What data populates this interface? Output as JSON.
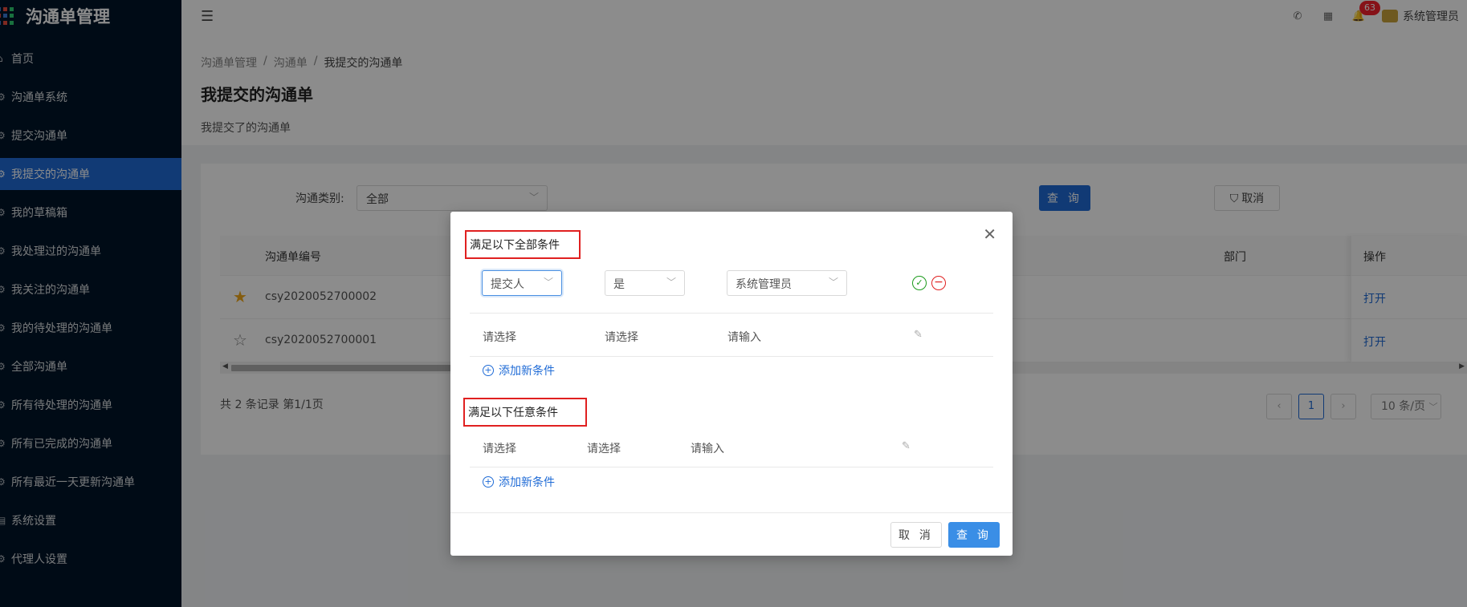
{
  "app": {
    "title": "沟通单管理"
  },
  "sidebar": {
    "items": [
      {
        "label": "首页",
        "icon": "home-icon",
        "glyph": "⌂"
      },
      {
        "label": "沟通单系统",
        "icon": "gear-icon",
        "glyph": "⚙"
      },
      {
        "label": "提交沟通单",
        "icon": "gear-icon",
        "glyph": "⚙"
      },
      {
        "label": "我提交的沟通单",
        "icon": "gear-icon",
        "glyph": "⚙",
        "active": true
      },
      {
        "label": "我的草稿箱",
        "icon": "gear-icon",
        "glyph": "⚙"
      },
      {
        "label": "我处理过的沟通单",
        "icon": "gear-icon",
        "glyph": "⚙"
      },
      {
        "label": "我关注的沟通单",
        "icon": "gear-icon",
        "glyph": "⚙"
      },
      {
        "label": "我的待处理的沟通单",
        "icon": "gear-icon",
        "glyph": "⚙"
      },
      {
        "label": "全部沟通单",
        "icon": "gear-icon",
        "glyph": "⚙"
      },
      {
        "label": "所有待处理的沟通单",
        "icon": "gear-icon",
        "glyph": "⚙"
      },
      {
        "label": "所有已完成的沟通单",
        "icon": "gear-icon",
        "glyph": "⚙"
      },
      {
        "label": "所有最近一天更新沟通单",
        "icon": "gear-icon",
        "glyph": "⚙"
      },
      {
        "label": "系统设置",
        "icon": "settings-icon",
        "glyph": "▤"
      },
      {
        "label": "代理人设置",
        "icon": "gear-icon",
        "glyph": "⚙"
      }
    ]
  },
  "header": {
    "notification_count": "63",
    "username": "系统管理员"
  },
  "page": {
    "breadcrumb": [
      "沟通单管理",
      "沟通单",
      "我提交的沟通单"
    ],
    "title": "我提交的沟通单",
    "description": "我提交了的沟通单"
  },
  "filter": {
    "label": "沟通类别:",
    "value": "全部",
    "query_label": "查 询",
    "cancel_label": "取消"
  },
  "table": {
    "columns": {
      "number": "沟通单编号",
      "dept": "部门",
      "action": "操作"
    },
    "rows": [
      {
        "starred": true,
        "number": "csy2020052700002",
        "action": "打开"
      },
      {
        "starred": false,
        "number": "csy2020052700001",
        "action": "打开"
      }
    ],
    "total": "共 2 条记录 第1/1页",
    "page": "1",
    "page_size": "10 条/页"
  },
  "modal": {
    "group_all_title": "满足以下全部条件",
    "group_any_title": "满足以下任意条件",
    "active_condition": {
      "field": "提交人",
      "operator": "是",
      "value": "系统管理员"
    },
    "empty_condition_all": {
      "field": "请选择",
      "operator": "请选择",
      "value": "请输入"
    },
    "empty_condition_any": {
      "field": "请选择",
      "operator": "请选择",
      "value": "请输入"
    },
    "add_condition_label": "添加新条件",
    "cancel_label": "取 消",
    "query_label": "查 询"
  },
  "colors": {
    "primary": "#1f6bd6",
    "sidebar_bg": "#001529",
    "danger": "#e02020",
    "success": "#1a9a1a",
    "star": "#f0a81a"
  }
}
